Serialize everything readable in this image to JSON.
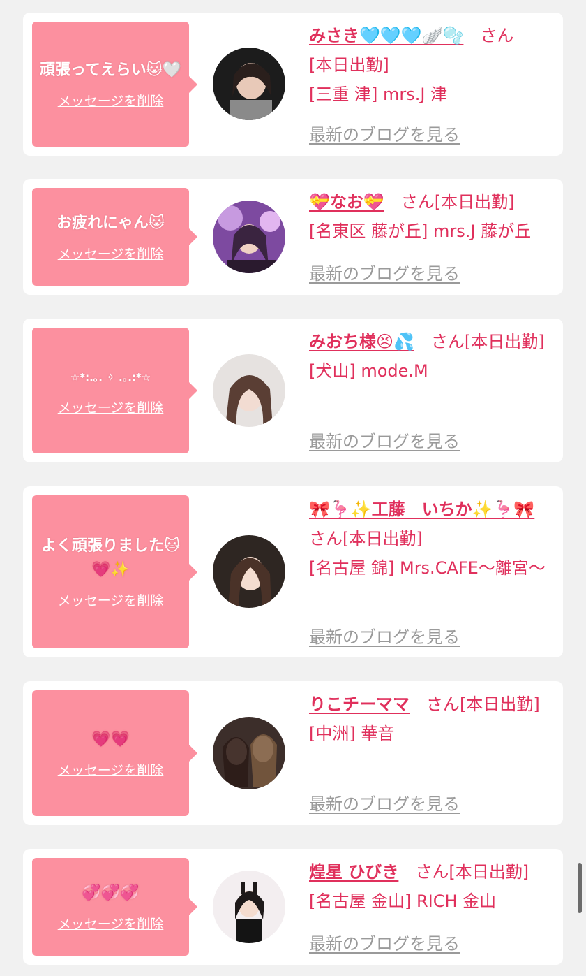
{
  "delete_label": "メッセージを削除",
  "blog_label": "最新のブログを見る",
  "san_label": "さん",
  "cards": [
    {
      "message": "頑張ってえらい🐱🤍",
      "name": "みさき🩵🩵🩵🪽🫧",
      "status": "[本日出勤]",
      "shop": "[三重 津] mrs.J 津"
    },
    {
      "message": "お疲れにゃん🐱",
      "name": "💝なお💝",
      "status": "[本日出勤]",
      "shop": "[名東区 藤が丘] mrs.J 藤が丘"
    },
    {
      "message": "☆*:.｡. ✧ .｡.:*☆",
      "name": "みおち様😣💦",
      "status": "[本日出勤]",
      "shop": "[犬山] mode.M"
    },
    {
      "message": "よく頑張りました🐱💗✨",
      "name": "🎀🦩✨工藤　いちか✨🦩🎀",
      "status": "[本日出勤]",
      "shop": "[名古屋 錦] Mrs.CAFE～離宮～"
    },
    {
      "message": "💗💗",
      "name": "りこチーママ",
      "status": "[本日出勤]",
      "shop": "[中洲] 華音"
    },
    {
      "message": "💞💞💞",
      "name": "煌星 ひびき",
      "status": "[本日出勤]",
      "shop": "[名古屋 金山] RICH 金山"
    }
  ]
}
